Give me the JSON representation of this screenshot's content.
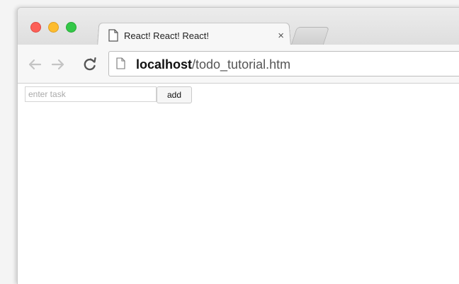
{
  "browser": {
    "tab": {
      "title": "React! React! React!",
      "close_glyph": "×",
      "page_icon": "page-icon"
    },
    "new_tab_icon": "new-tab-icon",
    "navigation": {
      "back_icon": "arrow-left-icon",
      "forward_icon": "arrow-right-icon",
      "reload_icon": "reload-icon"
    },
    "address_bar": {
      "host": "localhost",
      "path": "/todo_tutorial.htm",
      "page_icon": "page-icon"
    },
    "colors": {
      "close": "#fc5f57",
      "minimize": "#fdbc2e",
      "maximize": "#33c748"
    }
  },
  "page": {
    "task_input": {
      "placeholder": "enter task",
      "value": ""
    },
    "add_button_label": "add"
  }
}
